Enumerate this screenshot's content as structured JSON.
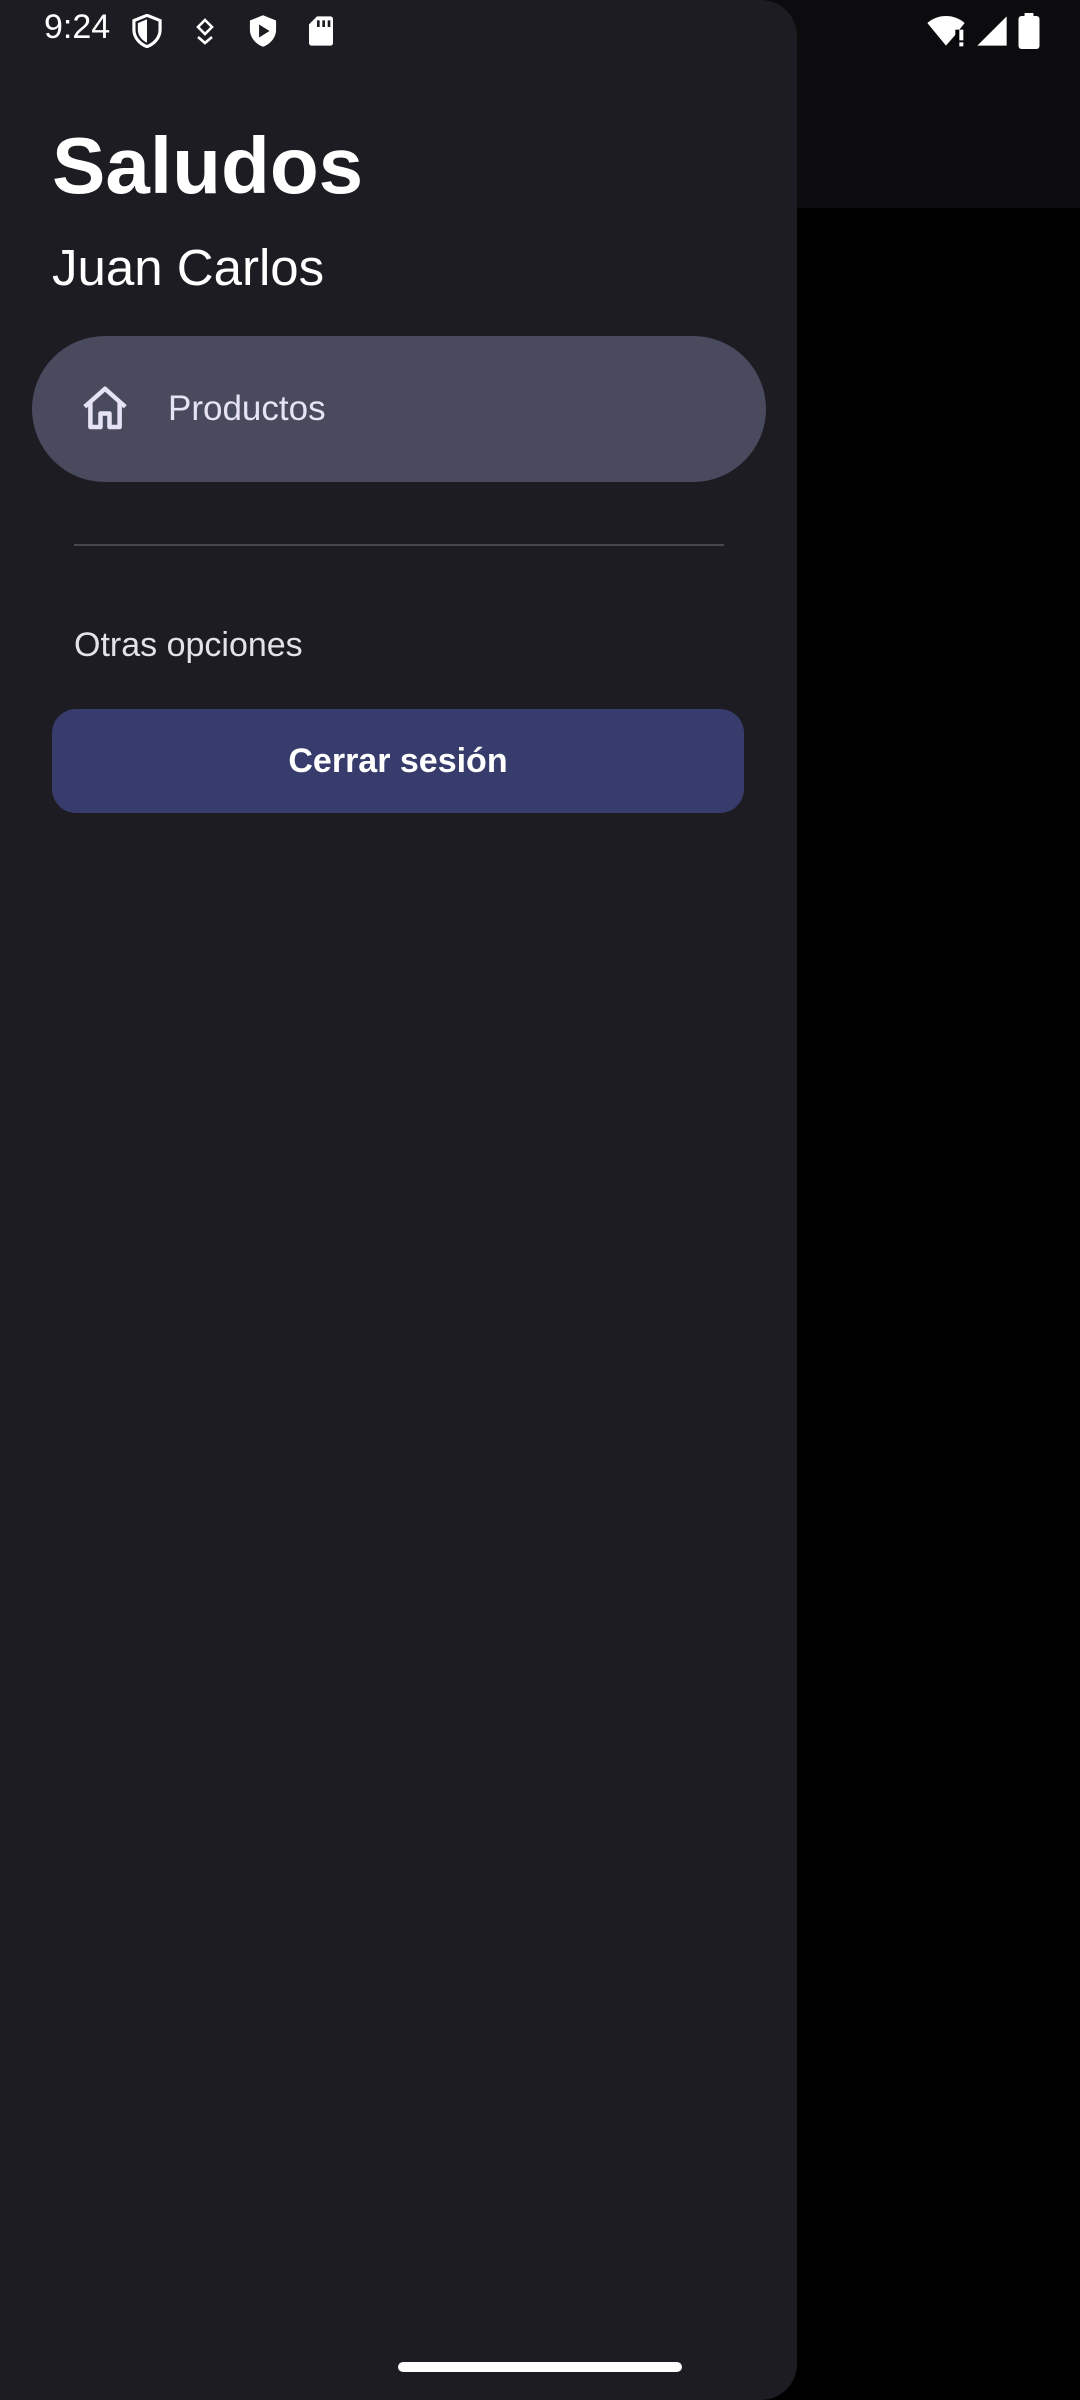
{
  "status_bar": {
    "time": "9:24",
    "left_icons": [
      "shield-outline-icon",
      "location-pin-icon",
      "play-shield-icon",
      "sd-card-icon"
    ],
    "right_icons": [
      "wifi-alert-icon",
      "cellular-signal-icon",
      "battery-full-icon"
    ]
  },
  "drawer": {
    "greeting": "Saludos",
    "user_name": "Juan Carlos",
    "nav_items": [
      {
        "label": "Productos",
        "icon": "home-icon",
        "selected": true
      }
    ],
    "section_label": "Otras opciones",
    "logout_label": "Cerrar sesión"
  },
  "colors": {
    "drawer_bg": "#1d1c22",
    "selected_item_bg": "#4a4a5e",
    "logout_button_bg": "#383c6c",
    "scrim_bg": "#000000",
    "text_primary": "#ffffff"
  }
}
